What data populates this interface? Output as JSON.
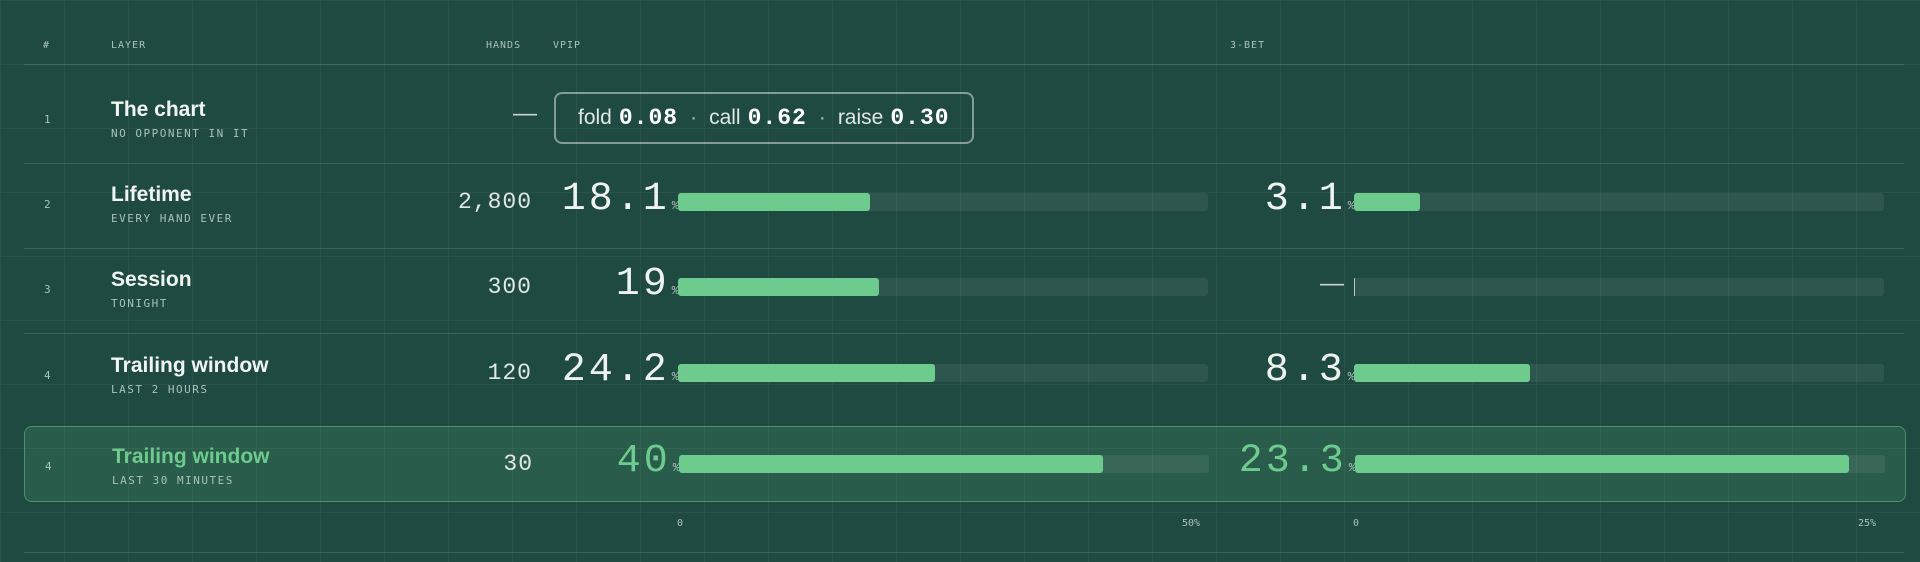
{
  "header": {
    "col_num": "#",
    "col_layer": "LAYER",
    "col_hands": "HANDS",
    "col_vpip": "VPIP",
    "col_3bet": "3-BET"
  },
  "chart_row": {
    "num": "1",
    "name": "The chart",
    "sub": "NO OPPONENT IN IT",
    "hands": "—",
    "fold_label": "fold",
    "fold_value": "0.08",
    "call_label": "call",
    "call_value": "0.62",
    "raise_label": "raise",
    "raise_value": "0.30",
    "sep": "·"
  },
  "rows": [
    {
      "num": "2",
      "name": "Lifetime",
      "sub": "EVERY HAND EVER",
      "hands": "2,800",
      "vpip": "18.1",
      "vpip_value": 18.1,
      "threebet": "3.1",
      "threebet_value": 3.1
    },
    {
      "num": "3",
      "name": "Session",
      "sub": "TONIGHT",
      "hands": "300",
      "vpip": "19",
      "vpip_value": 19,
      "threebet": "—",
      "threebet_value": 0
    },
    {
      "num": "4",
      "name": "Trailing window",
      "sub": "LAST 2 HOURS",
      "hands": "120",
      "vpip": "24.2",
      "vpip_value": 24.2,
      "threebet": "8.3",
      "threebet_value": 8.3
    },
    {
      "num": "4",
      "name": "Trailing window",
      "sub": "LAST 30 MINUTES",
      "hands": "30",
      "vpip": "40",
      "vpip_value": 40,
      "threebet": "23.3",
      "threebet_value": 23.3,
      "highlighted": true
    }
  ],
  "pct_sign": "%",
  "axes": {
    "vpip_min": "0",
    "vpip_max": "50%",
    "vpip_max_value": 50,
    "threebet_min": "0",
    "threebet_max": "25%",
    "threebet_max_value": 25
  },
  "colors": {
    "accent": "#6dcb8e",
    "background": "#1f4a41"
  }
}
